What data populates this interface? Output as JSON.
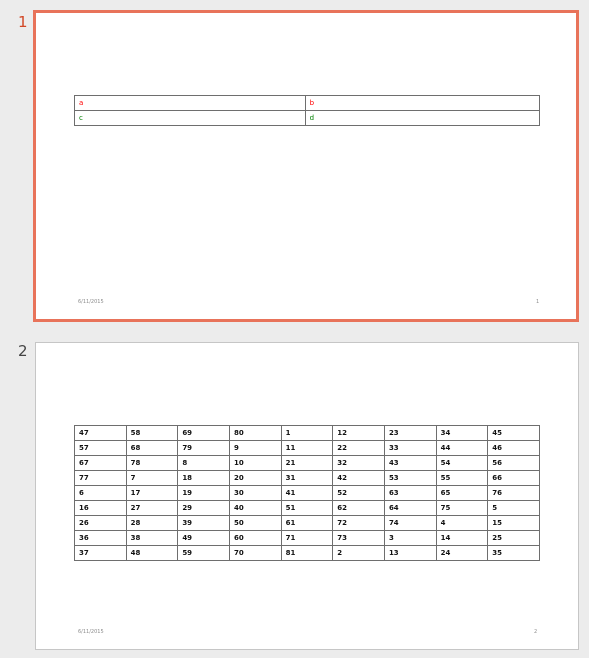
{
  "slides": [
    {
      "number": "1",
      "table": {
        "rows": [
          [
            {
              "text": "a",
              "color": "#ff0000"
            },
            {
              "text": "b",
              "color": "#ff0000"
            }
          ],
          [
            {
              "text": "c",
              "color": "#008000"
            },
            {
              "text": "d",
              "color": "#008000"
            }
          ]
        ]
      },
      "footer_date": "6/11/2015",
      "footer_page": "1"
    },
    {
      "number": "2",
      "table": {
        "rows": [
          [
            "47",
            "58",
            "69",
            "80",
            "1",
            "12",
            "23",
            "34",
            "45"
          ],
          [
            "57",
            "68",
            "79",
            "9",
            "11",
            "22",
            "33",
            "44",
            "46"
          ],
          [
            "67",
            "78",
            "8",
            "10",
            "21",
            "32",
            "43",
            "54",
            "56"
          ],
          [
            "77",
            "7",
            "18",
            "20",
            "31",
            "42",
            "53",
            "55",
            "66"
          ],
          [
            "6",
            "17",
            "19",
            "30",
            "41",
            "52",
            "63",
            "65",
            "76"
          ],
          [
            "16",
            "27",
            "29",
            "40",
            "51",
            "62",
            "64",
            "75",
            "5"
          ],
          [
            "26",
            "28",
            "39",
            "50",
            "61",
            "72",
            "74",
            "4",
            "15"
          ],
          [
            "36",
            "38",
            "49",
            "60",
            "71",
            "73",
            "3",
            "14",
            "25"
          ],
          [
            "37",
            "48",
            "59",
            "70",
            "81",
            "2",
            "13",
            "24",
            "35"
          ]
        ]
      },
      "footer_date": "6/11/2015",
      "footer_page": "2"
    }
  ],
  "colors": {
    "selected_border": "#e8735a",
    "selected_number": "#d24726",
    "pane_background": "#ececec"
  }
}
